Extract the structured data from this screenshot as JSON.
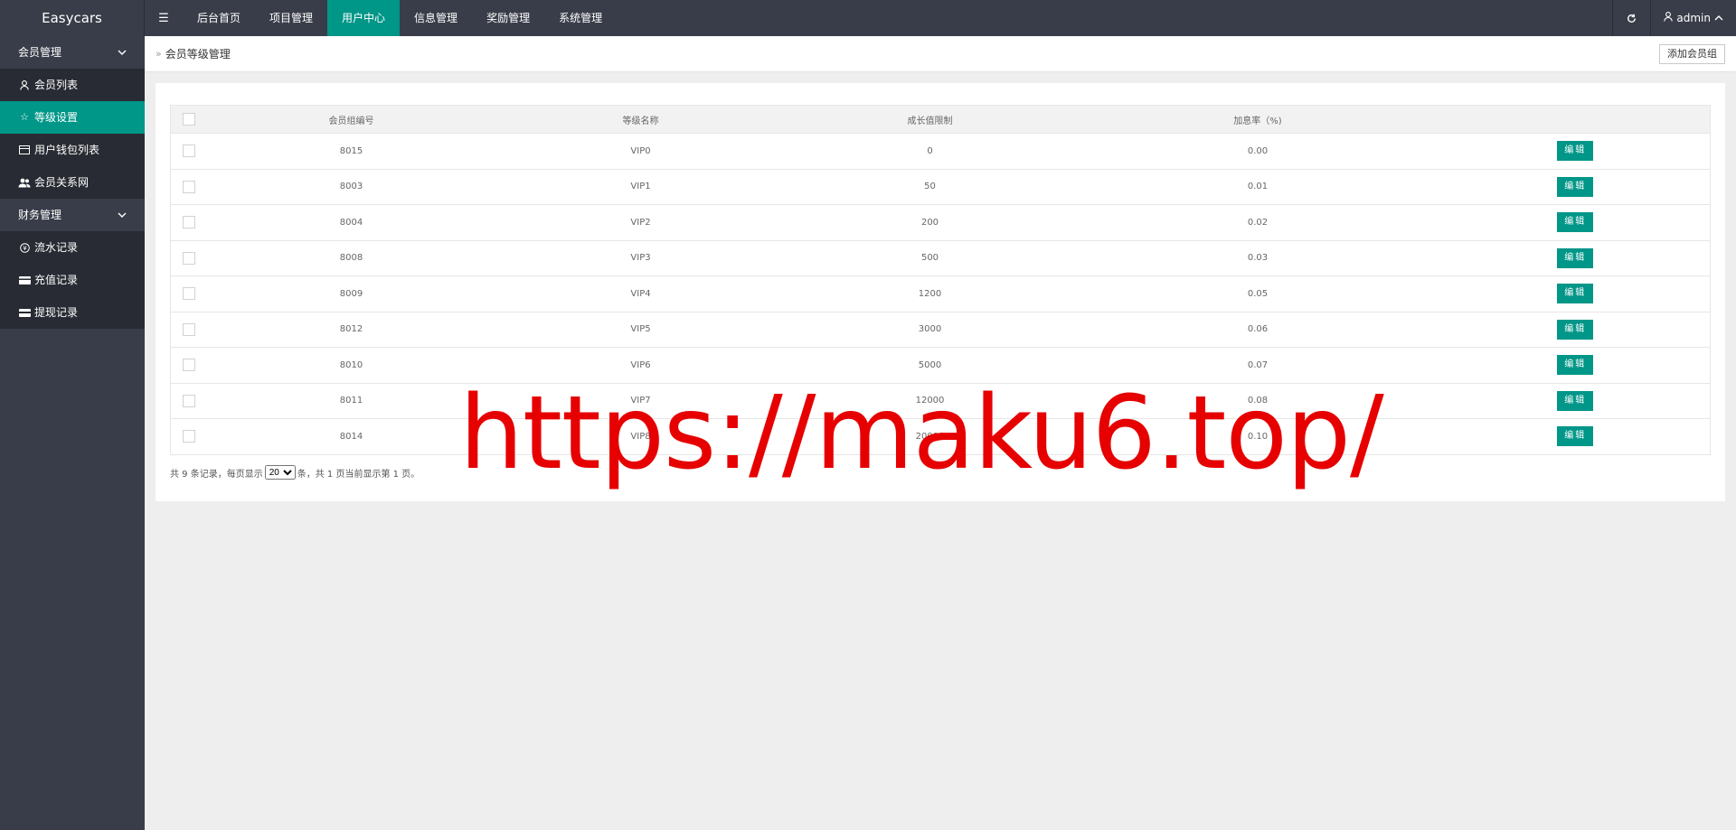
{
  "app": {
    "title": "Easycars"
  },
  "topnav": {
    "toggle_icon": "menu-icon",
    "items": [
      {
        "label": "后台首页"
      },
      {
        "label": "项目管理"
      },
      {
        "label": "用户中心"
      },
      {
        "label": "信息管理"
      },
      {
        "label": "奖励管理"
      },
      {
        "label": "系统管理"
      }
    ],
    "active_index": 2,
    "user": "admin"
  },
  "sidebar": {
    "groups": [
      {
        "label": "会员管理",
        "items": [
          {
            "label": "会员列表",
            "icon": "user-icon"
          },
          {
            "label": "等级设置",
            "icon": "star-icon",
            "active": true
          },
          {
            "label": "用户钱包列表",
            "icon": "wallet-icon"
          },
          {
            "label": "会员关系网",
            "icon": "users-icon"
          }
        ]
      },
      {
        "label": "财务管理",
        "items": [
          {
            "label": "流水记录",
            "icon": "money-icon"
          },
          {
            "label": "充值记录",
            "icon": "card-icon"
          },
          {
            "label": "提现记录",
            "icon": "credit-card-icon"
          }
        ]
      }
    ]
  },
  "breadcrumb": {
    "current": "会员等级管理",
    "add_button": "添加会员组"
  },
  "table": {
    "headers": [
      "会员组编号",
      "等级名称",
      "成长值限制",
      "加息率（%)"
    ],
    "edit_label": "编辑",
    "rows": [
      {
        "id": "8015",
        "name": "VIP0",
        "limit": "0",
        "rate": "0.00"
      },
      {
        "id": "8003",
        "name": "VIP1",
        "limit": "50",
        "rate": "0.01"
      },
      {
        "id": "8004",
        "name": "VIP2",
        "limit": "200",
        "rate": "0.02"
      },
      {
        "id": "8008",
        "name": "VIP3",
        "limit": "500",
        "rate": "0.03"
      },
      {
        "id": "8009",
        "name": "VIP4",
        "limit": "1200",
        "rate": "0.05"
      },
      {
        "id": "8012",
        "name": "VIP5",
        "limit": "3000",
        "rate": "0.06"
      },
      {
        "id": "8010",
        "name": "VIP6",
        "limit": "5000",
        "rate": "0.07"
      },
      {
        "id": "8011",
        "name": "VIP7",
        "limit": "12000",
        "rate": "0.08"
      },
      {
        "id": "8014",
        "name": "VIP8",
        "limit": "20000",
        "rate": "0.10"
      }
    ]
  },
  "pager": {
    "prefix": "共 9 条记录，每页显示",
    "page_size": "20",
    "suffix": "条，共 1 页当前显示第 1 页。"
  },
  "watermark": "https://maku6.top/",
  "colors": {
    "accent": "#009688",
    "topbar": "#393d49",
    "watermark": "#e60000"
  }
}
